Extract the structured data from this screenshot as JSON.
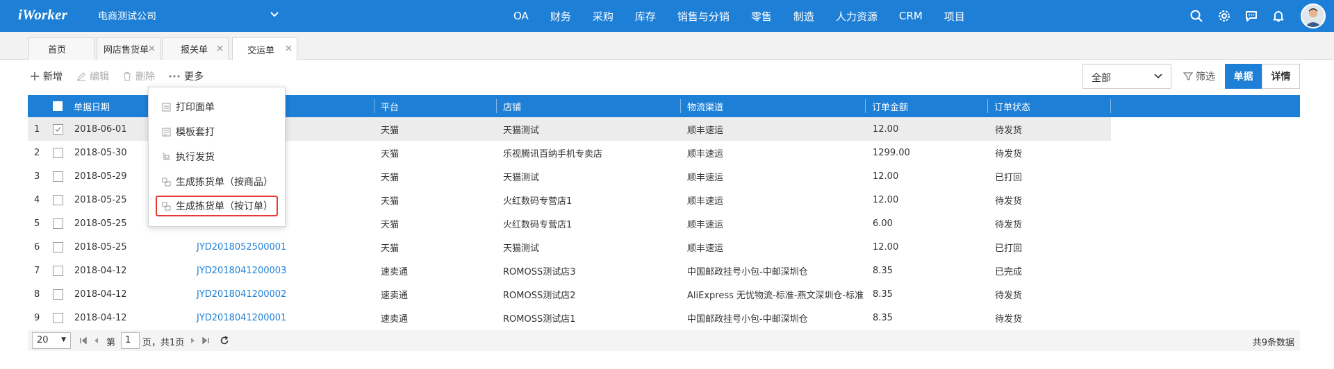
{
  "header": {
    "logo": "iWorker",
    "company": "电商测试公司",
    "nav": [
      "OA",
      "财务",
      "采购",
      "库存",
      "销售与分销",
      "零售",
      "制造",
      "人力资源",
      "CRM",
      "项目"
    ]
  },
  "tabs": [
    {
      "label": "首页"
    },
    {
      "label": "网店售货单"
    },
    {
      "label": "报关单"
    },
    {
      "label": "交运单"
    }
  ],
  "toolbar": {
    "add": "新增",
    "edit": "编辑",
    "delete": "删除",
    "more": "更多",
    "select_value": "全部",
    "filter": "筛选",
    "view_docs": "单据",
    "view_details": "详情"
  },
  "menu": {
    "items": [
      "打印面单",
      "模板套打",
      "执行发货",
      "生成拣货单（按商品）",
      "生成拣货单（按订单）"
    ]
  },
  "table": {
    "headers": [
      "单据日期",
      "",
      "平台",
      "店铺",
      "物流渠道",
      "订单金额",
      "订单状态"
    ],
    "rows": [
      {
        "no": "1",
        "date": "2018-06-01",
        "doc": "",
        "platform": "天猫",
        "shop": "天猫测试",
        "logistics": "顺丰速运",
        "amount": "12.00",
        "status": "待发货"
      },
      {
        "no": "2",
        "date": "2018-05-30",
        "doc": "",
        "platform": "天猫",
        "shop": "乐视腾讯百纳手机专卖店",
        "logistics": "顺丰速运",
        "amount": "1299.00",
        "status": "待发货"
      },
      {
        "no": "3",
        "date": "2018-05-29",
        "doc": "",
        "platform": "天猫",
        "shop": "天猫测试",
        "logistics": "顺丰速运",
        "amount": "12.00",
        "status": "已打回"
      },
      {
        "no": "4",
        "date": "2018-05-25",
        "doc": "",
        "platform": "天猫",
        "shop": "火红数码专营店1",
        "logistics": "顺丰速运",
        "amount": "12.00",
        "status": "待发货"
      },
      {
        "no": "5",
        "date": "2018-05-25",
        "doc": "",
        "platform": "天猫",
        "shop": "火红数码专营店1",
        "logistics": "顺丰速运",
        "amount": "6.00",
        "status": "待发货"
      },
      {
        "no": "6",
        "date": "2018-05-25",
        "doc": "JYD2018052500001",
        "platform": "天猫",
        "shop": "天猫测试",
        "logistics": "顺丰速运",
        "amount": "12.00",
        "status": "已打回"
      },
      {
        "no": "7",
        "date": "2018-04-12",
        "doc": "JYD2018041200003",
        "platform": "速卖通",
        "shop": "ROMOSS测试店3",
        "logistics": "中国邮政挂号小包-中邮深圳仓",
        "amount": "8.35",
        "status": "已完成"
      },
      {
        "no": "8",
        "date": "2018-04-12",
        "doc": "JYD2018041200002",
        "platform": "速卖通",
        "shop": "ROMOSS测试店2",
        "logistics": "AliExpress 无忧物流-标准-燕文深圳仓-标准",
        "amount": "8.35",
        "status": "待发货"
      },
      {
        "no": "9",
        "date": "2018-04-12",
        "doc": "JYD2018041200001",
        "platform": "速卖通",
        "shop": "ROMOSS测试店1",
        "logistics": "中国邮政挂号小包-中邮深圳仓",
        "amount": "8.35",
        "status": "待发货"
      }
    ]
  },
  "pager": {
    "page_size": "20",
    "page_prefix": "第",
    "page_value": "1",
    "page_suffix": "页，共1页",
    "total": "共9条数据"
  },
  "colors": {
    "primary": "#1e7fd6",
    "highlight_border": "#e53935"
  }
}
